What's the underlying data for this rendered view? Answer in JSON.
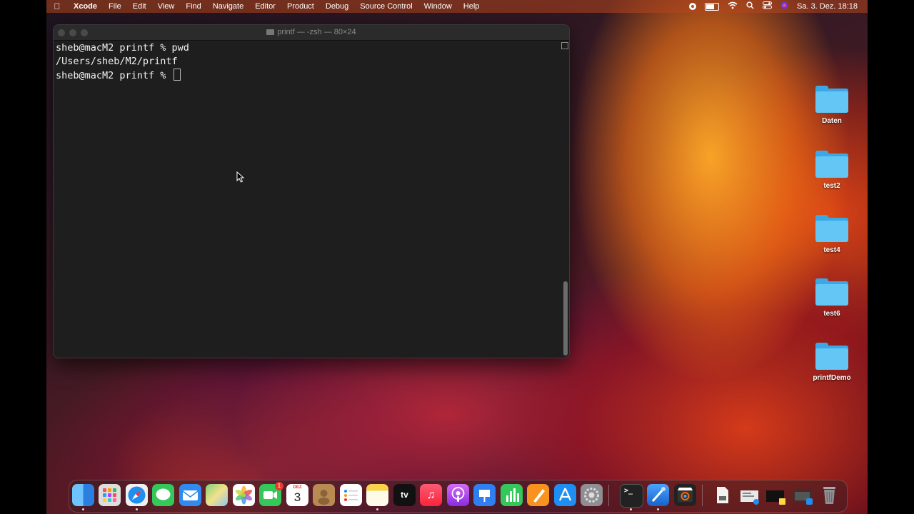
{
  "menubar": {
    "app_name": "Xcode",
    "menus": [
      "File",
      "Edit",
      "View",
      "Find",
      "Navigate",
      "Editor",
      "Product",
      "Debug",
      "Source Control",
      "Window",
      "Help"
    ],
    "datetime": "Sa. 3. Dez.  18:18"
  },
  "terminal": {
    "title": "printf — -zsh — 80×24",
    "lines": [
      "sheb@macM2 printf % pwd",
      "/Users/sheb/M2/printf",
      "sheb@macM2 printf % "
    ]
  },
  "desktop": {
    "items": [
      "Daten",
      "test2",
      "test4",
      "test6",
      "printfDemo"
    ]
  },
  "dock": {
    "calendar_month": "DEZ",
    "calendar_day": "3",
    "facetime_badge": "1",
    "tv_label": "tv",
    "terminal_glyph": ">_"
  }
}
